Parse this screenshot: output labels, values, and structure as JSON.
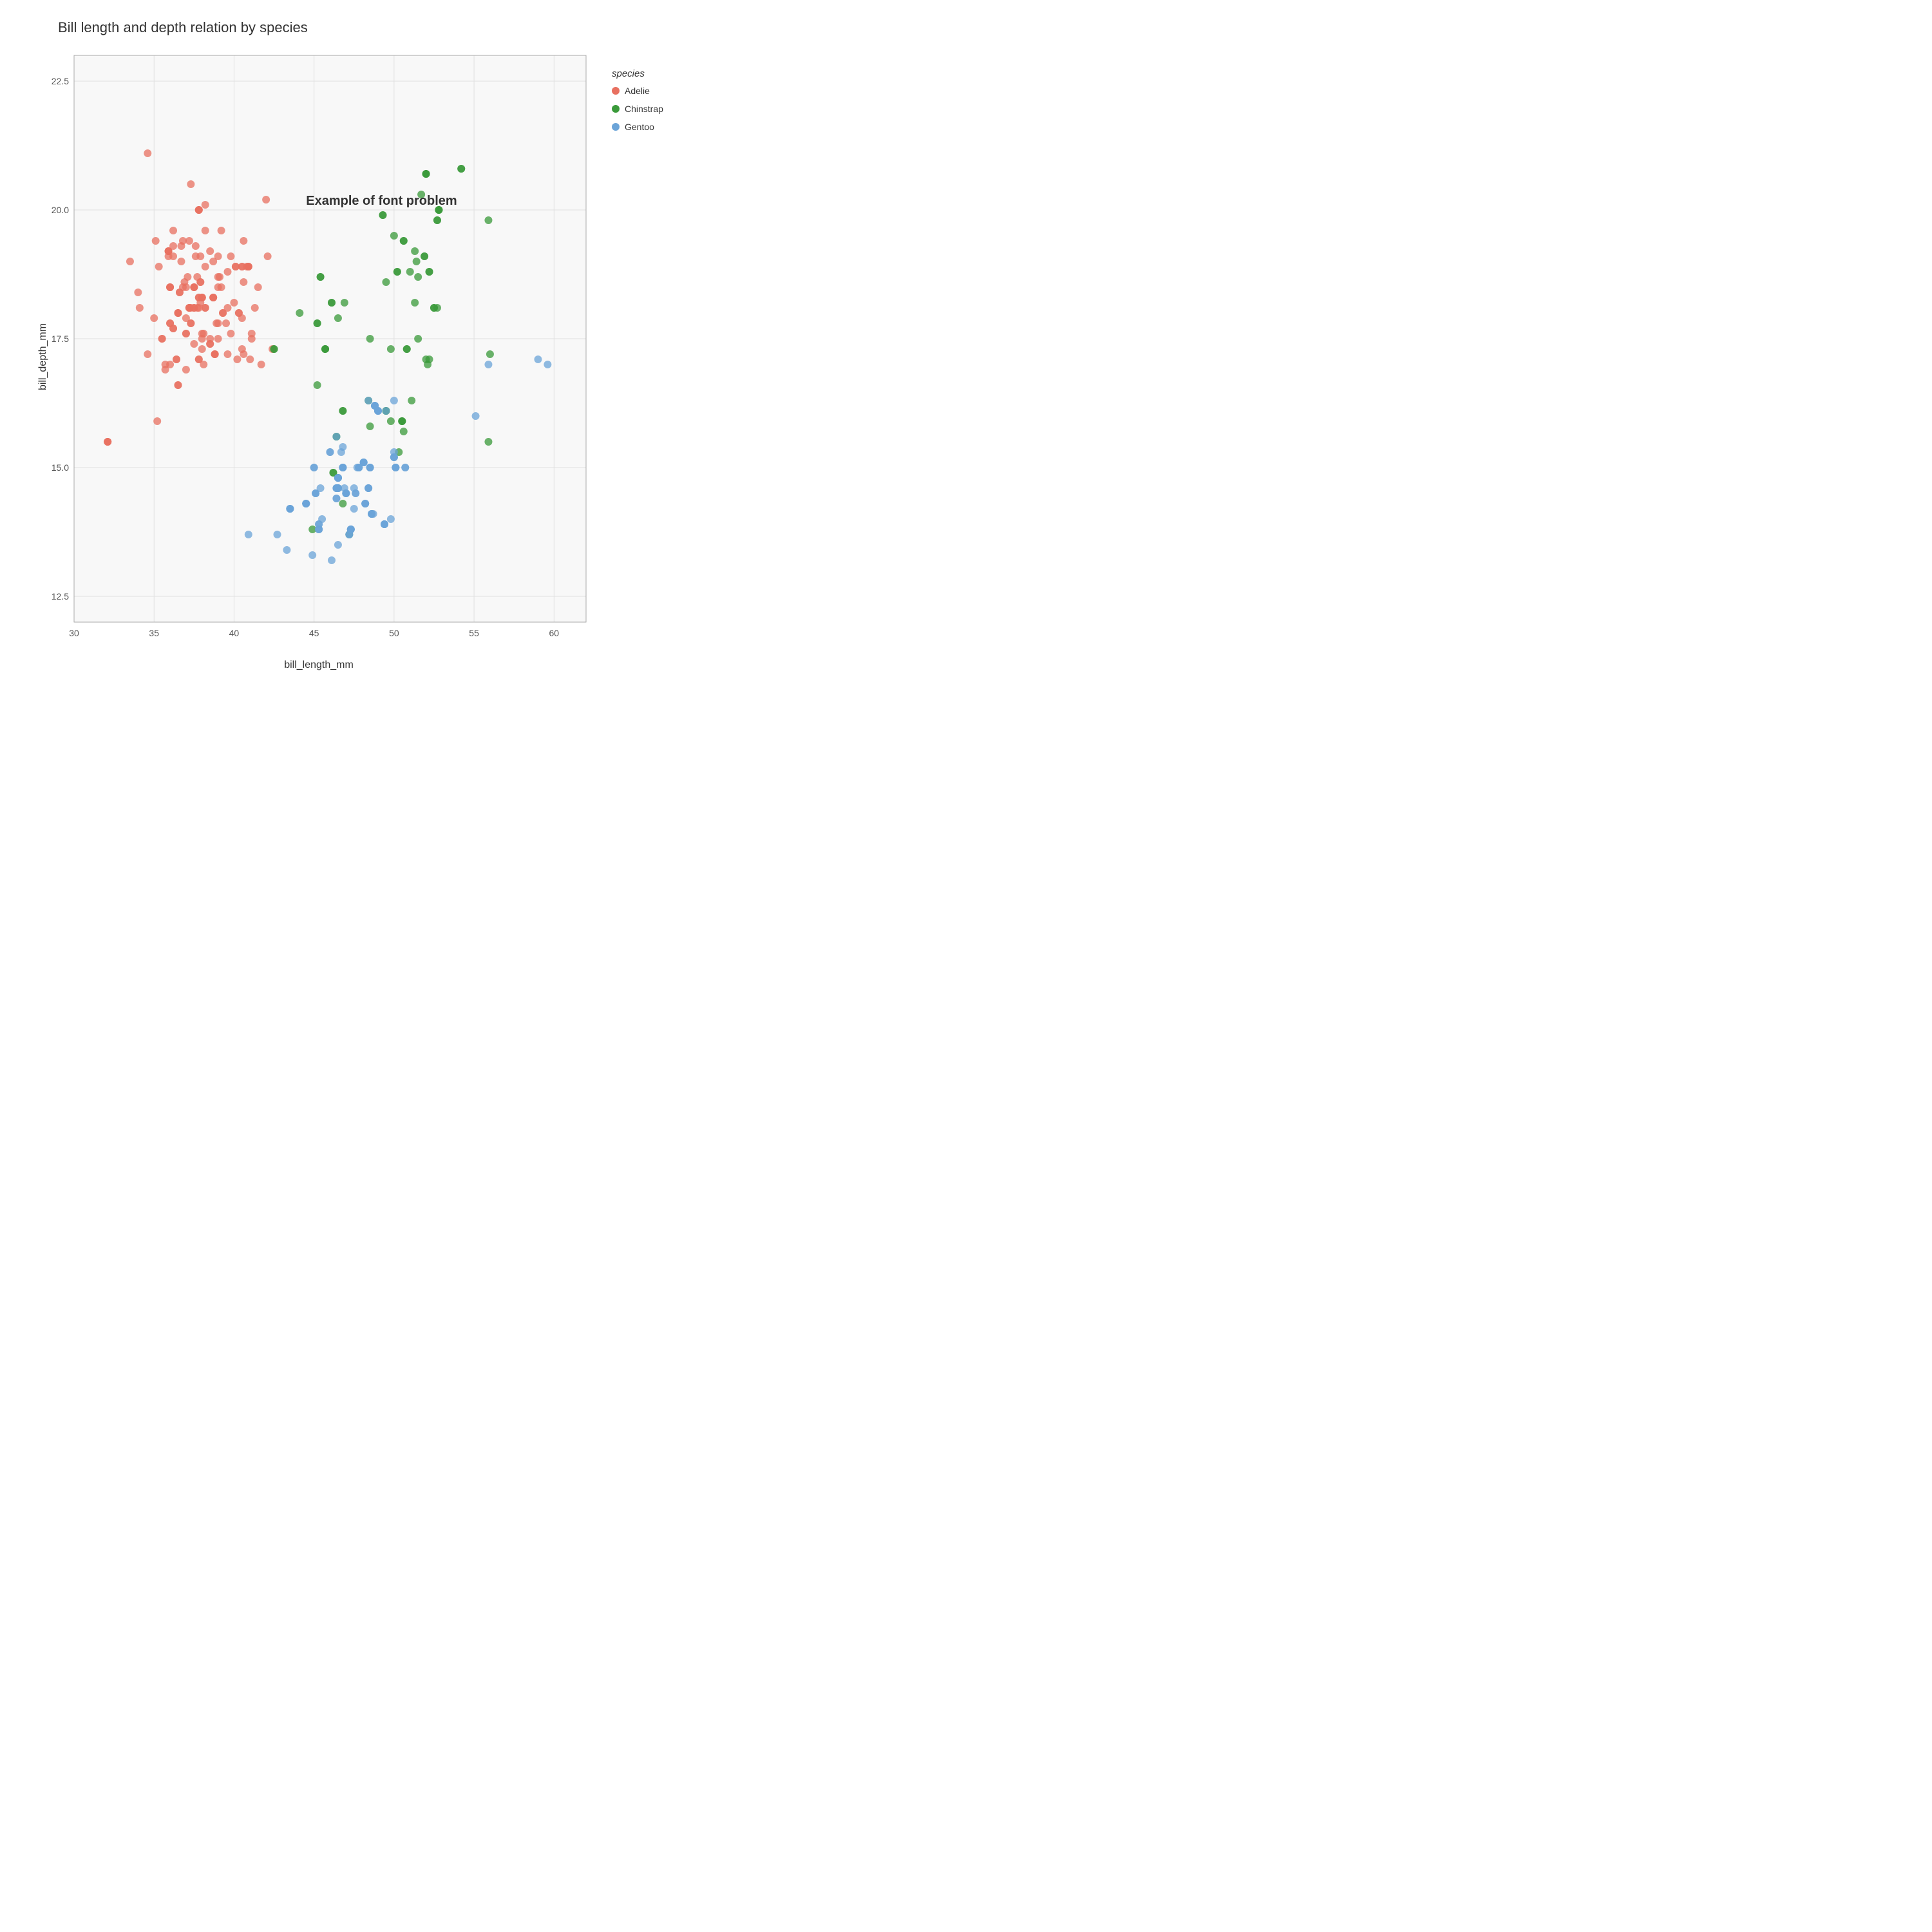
{
  "title": "Bill length and depth relation by species",
  "x_axis_label": "bill_length_mm",
  "y_axis_label": "bill_depth_mm",
  "annotation": "Example of font problem",
  "legend": {
    "title": "species",
    "items": [
      {
        "label": "Adelie",
        "color": "#E87060"
      },
      {
        "label": "Chinstrap",
        "color": "#3A9A3A"
      },
      {
        "label": "Gentoo",
        "color": "#6BA4D8"
      }
    ]
  },
  "x_ticks": [
    30,
    35,
    40,
    45,
    50,
    55,
    60
  ],
  "y_ticks": [
    12.5,
    15.0,
    17.5,
    20.0
  ],
  "x_tick_labels": [
    "",
    "35",
    "40",
    "45",
    "50",
    "55",
    "60"
  ],
  "y_tick_labels": [
    "",
    "15.0",
    "17.5",
    "20.0"
  ],
  "adelie_points": [
    [
      32.1,
      15.5
    ],
    [
      33.5,
      19.0
    ],
    [
      35.7,
      16.9
    ],
    [
      36.7,
      19.3
    ],
    [
      37.8,
      18.3
    ],
    [
      38.9,
      17.8
    ],
    [
      39.2,
      19.6
    ],
    [
      36.5,
      18.0
    ],
    [
      34.0,
      18.4
    ],
    [
      35.9,
      19.2
    ],
    [
      38.2,
      18.1
    ],
    [
      37.7,
      18.7
    ],
    [
      35.3,
      18.9
    ],
    [
      40.3,
      18.0
    ],
    [
      36.7,
      19.0
    ],
    [
      40.1,
      18.9
    ],
    [
      37.0,
      16.9
    ],
    [
      37.3,
      20.5
    ],
    [
      37.8,
      20.0
    ],
    [
      39.0,
      17.5
    ],
    [
      34.1,
      18.1
    ],
    [
      37.2,
      19.4
    ],
    [
      38.1,
      17.0
    ],
    [
      40.2,
      17.1
    ],
    [
      38.5,
      17.5
    ],
    [
      39.5,
      17.8
    ],
    [
      38.7,
      19.0
    ],
    [
      39.0,
      18.7
    ],
    [
      38.2,
      18.1
    ],
    [
      40.6,
      17.2
    ],
    [
      36.5,
      18.0
    ],
    [
      40.5,
      17.9
    ],
    [
      37.9,
      18.6
    ],
    [
      40.8,
      18.9
    ],
    [
      36.0,
      17.8
    ],
    [
      41.1,
      17.6
    ],
    [
      38.0,
      17.3
    ],
    [
      37.8,
      17.1
    ],
    [
      35.9,
      19.1
    ],
    [
      38.2,
      18.9
    ],
    [
      38.8,
      17.2
    ],
    [
      35.5,
      17.5
    ],
    [
      37.9,
      19.1
    ],
    [
      37.2,
      18.1
    ],
    [
      36.2,
      17.7
    ],
    [
      37.1,
      18.7
    ],
    [
      37.5,
      18.5
    ],
    [
      36.0,
      17.0
    ],
    [
      38.0,
      18.3
    ],
    [
      39.1,
      18.7
    ],
    [
      40.5,
      18.9
    ],
    [
      36.4,
      17.1
    ],
    [
      39.8,
      17.6
    ],
    [
      41.1,
      17.5
    ],
    [
      37.6,
      19.3
    ],
    [
      38.8,
      17.2
    ],
    [
      36.6,
      18.4
    ],
    [
      36.0,
      18.5
    ],
    [
      37.8,
      18.1
    ],
    [
      39.6,
      17.2
    ],
    [
      40.9,
      18.9
    ],
    [
      36.5,
      16.6
    ],
    [
      41.5,
      18.5
    ],
    [
      38.5,
      17.4
    ],
    [
      39.0,
      17.8
    ],
    [
      35.7,
      17.0
    ],
    [
      36.2,
      19.3
    ],
    [
      40.6,
      18.6
    ],
    [
      38.7,
      18.3
    ],
    [
      34.6,
      21.1
    ],
    [
      37.3,
      17.8
    ],
    [
      41.3,
      18.1
    ],
    [
      36.8,
      19.4
    ],
    [
      36.5,
      18.0
    ],
    [
      37.0,
      17.6
    ],
    [
      38.0,
      18.3
    ],
    [
      39.0,
      19.1
    ],
    [
      40.0,
      18.2
    ],
    [
      37.5,
      17.4
    ],
    [
      37.8,
      20.0
    ],
    [
      36.0,
      18.5
    ],
    [
      38.7,
      18.3
    ],
    [
      38.0,
      17.5
    ],
    [
      37.3,
      18.1
    ],
    [
      38.5,
      19.2
    ],
    [
      37.7,
      18.1
    ],
    [
      38.2,
      19.6
    ],
    [
      36.2,
      19.1
    ],
    [
      38.0,
      17.6
    ],
    [
      36.2,
      19.6
    ],
    [
      37.9,
      18.6
    ],
    [
      37.5,
      18.1
    ],
    [
      39.3,
      18.0
    ],
    [
      39.2,
      18.5
    ],
    [
      40.6,
      19.4
    ],
    [
      35.1,
      19.4
    ],
    [
      34.6,
      17.2
    ],
    [
      39.6,
      18.8
    ],
    [
      40.5,
      17.3
    ],
    [
      41.0,
      17.1
    ],
    [
      42.1,
      19.1
    ],
    [
      35.2,
      15.9
    ],
    [
      32.1,
      15.5
    ],
    [
      37.6,
      19.1
    ],
    [
      41.7,
      17.0
    ],
    [
      37.8,
      18.3
    ],
    [
      37.0,
      18.5
    ],
    [
      37.9,
      18.2
    ],
    [
      38.7,
      18.3
    ],
    [
      36.0,
      17.8
    ],
    [
      35.9,
      19.2
    ],
    [
      37.3,
      17.8
    ],
    [
      37.0,
      17.9
    ],
    [
      35.5,
      17.5
    ],
    [
      38.5,
      17.4
    ],
    [
      36.4,
      17.1
    ],
    [
      35.9,
      19.2
    ],
    [
      37.2,
      18.1
    ],
    [
      36.9,
      18.6
    ],
    [
      37.8,
      17.1
    ],
    [
      39.0,
      18.5
    ],
    [
      39.3,
      18.0
    ],
    [
      38.1,
      17.6
    ],
    [
      37.2,
      18.1
    ],
    [
      42.4,
      17.3
    ],
    [
      39.6,
      18.1
    ],
    [
      40.1,
      18.9
    ],
    [
      35.0,
      17.9
    ],
    [
      42.0,
      20.2
    ],
    [
      40.9,
      18.9
    ],
    [
      36.5,
      16.6
    ],
    [
      37.5,
      18.5
    ],
    [
      36.8,
      18.5
    ],
    [
      36.2,
      17.7
    ],
    [
      37.8,
      20.0
    ],
    [
      38.8,
      17.2
    ],
    [
      40.5,
      18.9
    ],
    [
      36.6,
      18.4
    ],
    [
      40.3,
      18.0
    ],
    [
      38.2,
      20.1
    ],
    [
      32.1,
      15.5
    ],
    [
      36.0,
      18.5
    ],
    [
      39.8,
      19.1
    ],
    [
      37.0,
      17.6
    ],
    [
      38.0,
      18.3
    ],
    [
      37.5,
      18.1
    ],
    [
      40.9,
      18.9
    ],
    [
      37.5,
      18.5
    ]
  ],
  "chinstrap_points": [
    [
      46.5,
      17.9
    ],
    [
      50.0,
      19.5
    ],
    [
      51.3,
      19.2
    ],
    [
      45.4,
      18.7
    ],
    [
      52.7,
      19.8
    ],
    [
      45.2,
      17.8
    ],
    [
      46.1,
      18.2
    ],
    [
      51.9,
      19.1
    ],
    [
      46.8,
      16.1
    ],
    [
      52.0,
      20.7
    ],
    [
      50.5,
      15.9
    ],
    [
      49.5,
      16.1
    ],
    [
      46.4,
      15.6
    ],
    [
      52.8,
      20.0
    ],
    [
      44.9,
      13.8
    ],
    [
      50.8,
      17.3
    ],
    [
      52.5,
      18.1
    ],
    [
      42.5,
      17.3
    ],
    [
      54.2,
      20.8
    ],
    [
      45.7,
      17.3
    ],
    [
      45.7,
      17.3
    ],
    [
      52.2,
      18.8
    ],
    [
      49.3,
      19.9
    ],
    [
      50.2,
      18.8
    ],
    [
      50.6,
      19.4
    ],
    [
      50.5,
      15.9
    ],
    [
      51.3,
      18.2
    ],
    [
      45.4,
      18.7
    ],
    [
      52.7,
      19.8
    ],
    [
      45.2,
      17.8
    ],
    [
      46.1,
      18.2
    ],
    [
      51.9,
      19.1
    ],
    [
      46.8,
      16.1
    ],
    [
      52.0,
      20.7
    ],
    [
      50.5,
      15.9
    ],
    [
      49.5,
      16.1
    ],
    [
      46.4,
      15.6
    ],
    [
      52.8,
      20.0
    ],
    [
      50.8,
      17.3
    ],
    [
      52.5,
      18.1
    ],
    [
      42.5,
      17.3
    ],
    [
      54.2,
      20.8
    ],
    [
      45.7,
      17.3
    ],
    [
      52.2,
      18.8
    ],
    [
      49.3,
      19.9
    ],
    [
      50.2,
      18.8
    ],
    [
      50.6,
      19.4
    ],
    [
      48.5,
      17.5
    ],
    [
      52.8,
      20.0
    ],
    [
      55.9,
      15.5
    ],
    [
      44.1,
      18.0
    ],
    [
      49.5,
      16.1
    ],
    [
      52.0,
      17.1
    ],
    [
      56.0,
      17.2
    ],
    [
      46.9,
      18.2
    ],
    [
      48.4,
      16.3
    ],
    [
      51.1,
      16.3
    ],
    [
      48.5,
      15.8
    ],
    [
      55.9,
      19.8
    ],
    [
      47.2,
      13.7
    ],
    [
      46.8,
      14.3
    ],
    [
      52.0,
      20.7
    ],
    [
      51.4,
      19.0
    ],
    [
      50.3,
      15.3
    ],
    [
      50.6,
      15.7
    ],
    [
      49.8,
      17.3
    ],
    [
      46.2,
      14.9
    ],
    [
      51.7,
      20.3
    ],
    [
      52.7,
      18.1
    ],
    [
      52.2,
      17.1
    ],
    [
      45.2,
      16.6
    ],
    [
      49.5,
      18.6
    ],
    [
      49.8,
      15.9
    ],
    [
      46.2,
      14.9
    ],
    [
      51.0,
      18.8
    ],
    [
      51.5,
      18.7
    ],
    [
      52.1,
      17.0
    ],
    [
      51.5,
      17.5
    ]
  ],
  "gentoo_points": [
    [
      46.1,
      13.2
    ],
    [
      50.0,
      16.3
    ],
    [
      48.7,
      14.1
    ],
    [
      50.0,
      15.2
    ],
    [
      47.6,
      14.5
    ],
    [
      46.5,
      13.5
    ],
    [
      45.4,
      14.6
    ],
    [
      46.7,
      15.3
    ],
    [
      43.3,
      13.4
    ],
    [
      46.8,
      15.4
    ],
    [
      40.9,
      13.7
    ],
    [
      49.0,
      16.1
    ],
    [
      45.5,
      14.0
    ],
    [
      49.8,
      14.0
    ],
    [
      46.0,
      15.3
    ],
    [
      49.0,
      16.1
    ],
    [
      48.5,
      15.0
    ],
    [
      45.1,
      14.5
    ],
    [
      50.1,
      15.0
    ],
    [
      46.5,
      14.8
    ],
    [
      45.0,
      15.0
    ],
    [
      43.5,
      14.2
    ],
    [
      50.7,
      15.0
    ],
    [
      46.4,
      15.6
    ],
    [
      47.8,
      15.0
    ],
    [
      48.2,
      14.3
    ],
    [
      50.0,
      15.3
    ],
    [
      47.3,
      13.8
    ],
    [
      42.7,
      13.7
    ],
    [
      48.6,
      14.1
    ],
    [
      49.4,
      13.9
    ],
    [
      46.5,
      14.6
    ],
    [
      44.5,
      14.3
    ],
    [
      48.8,
      16.2
    ],
    [
      47.2,
      13.7
    ],
    [
      46.4,
      14.4
    ],
    [
      45.3,
      13.9
    ],
    [
      48.1,
      15.1
    ],
    [
      46.4,
      14.6
    ],
    [
      47.0,
      14.5
    ],
    [
      48.4,
      14.6
    ],
    [
      46.5,
      14.8
    ],
    [
      46.8,
      15.0
    ],
    [
      47.3,
      13.8
    ],
    [
      46.5,
      14.6
    ],
    [
      43.5,
      14.2
    ],
    [
      55.9,
      17.0
    ],
    [
      47.7,
      15.0
    ],
    [
      46.5,
      14.8
    ],
    [
      45.3,
      13.8
    ],
    [
      48.2,
      14.3
    ],
    [
      50.0,
      15.2
    ],
    [
      47.6,
      14.5
    ],
    [
      44.9,
      13.3
    ],
    [
      47.8,
      15.0
    ],
    [
      48.6,
      14.1
    ],
    [
      49.4,
      13.9
    ],
    [
      46.5,
      14.6
    ],
    [
      48.1,
      15.1
    ],
    [
      46.4,
      14.6
    ],
    [
      47.0,
      14.5
    ],
    [
      48.4,
      14.6
    ],
    [
      46.5,
      14.8
    ],
    [
      46.8,
      15.0
    ],
    [
      47.3,
      13.8
    ],
    [
      44.5,
      14.3
    ],
    [
      48.8,
      16.2
    ],
    [
      49.0,
      16.1
    ],
    [
      48.5,
      15.0
    ],
    [
      45.1,
      14.5
    ],
    [
      50.1,
      15.0
    ],
    [
      47.8,
      15.0
    ],
    [
      45.0,
      15.0
    ],
    [
      43.5,
      14.2
    ],
    [
      50.7,
      15.0
    ],
    [
      46.0,
      15.3
    ],
    [
      48.2,
      14.3
    ],
    [
      45.3,
      13.9
    ],
    [
      46.9,
      14.6
    ],
    [
      47.5,
      14.6
    ],
    [
      59.6,
      17.0
    ],
    [
      55.1,
      16.0
    ],
    [
      59.0,
      17.1
    ],
    [
      47.5,
      14.2
    ],
    [
      45.3,
      13.8
    ],
    [
      48.1,
      15.1
    ],
    [
      48.4,
      16.3
    ],
    [
      48.6,
      14.1
    ],
    [
      49.4,
      13.9
    ],
    [
      50.0,
      15.2
    ],
    [
      46.5,
      14.6
    ],
    [
      44.5,
      14.3
    ],
    [
      47.0,
      14.5
    ],
    [
      46.4,
      14.4
    ],
    [
      46.5,
      14.8
    ],
    [
      46.8,
      15.0
    ],
    [
      47.3,
      13.8
    ],
    [
      46.5,
      14.6
    ],
    [
      43.5,
      14.2
    ],
    [
      48.6,
      14.1
    ],
    [
      49.4,
      13.9
    ],
    [
      46.5,
      14.6
    ],
    [
      48.8,
      16.2
    ],
    [
      47.2,
      13.7
    ],
    [
      48.1,
      15.1
    ],
    [
      46.4,
      14.6
    ],
    [
      47.0,
      14.5
    ],
    [
      48.4,
      14.6
    ],
    [
      46.5,
      14.8
    ],
    [
      46.8,
      15.0
    ],
    [
      47.3,
      13.8
    ],
    [
      44.5,
      14.3
    ],
    [
      48.8,
      16.2
    ],
    [
      49.0,
      16.1
    ],
    [
      48.5,
      15.0
    ],
    [
      45.1,
      14.5
    ],
    [
      50.1,
      15.0
    ],
    [
      46.5,
      14.8
    ],
    [
      49.5,
      16.1
    ],
    [
      45.3,
      13.8
    ]
  ]
}
